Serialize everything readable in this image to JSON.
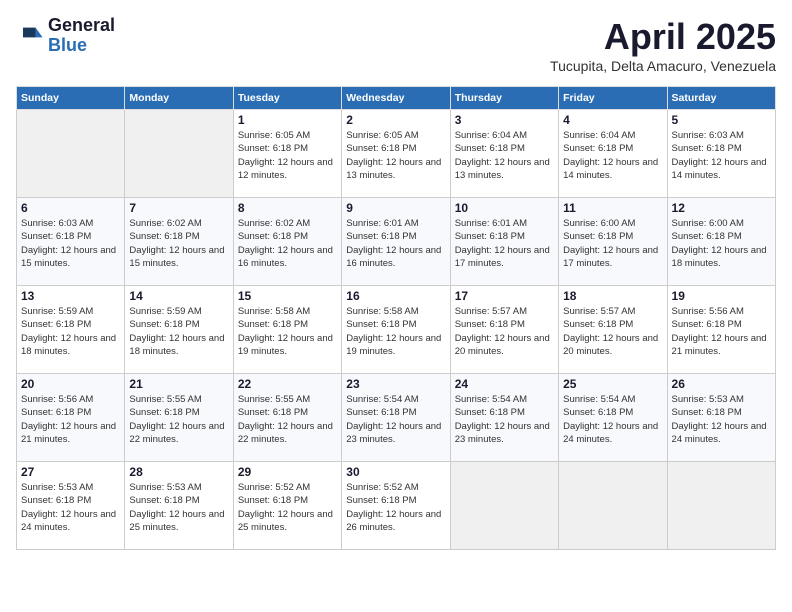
{
  "header": {
    "logo_general": "General",
    "logo_blue": "Blue",
    "month_title": "April 2025",
    "location": "Tucupita, Delta Amacuro, Venezuela"
  },
  "weekdays": [
    "Sunday",
    "Monday",
    "Tuesday",
    "Wednesday",
    "Thursday",
    "Friday",
    "Saturday"
  ],
  "weeks": [
    [
      {
        "day": null
      },
      {
        "day": null
      },
      {
        "day": "1",
        "sunrise": "6:05 AM",
        "sunset": "6:18 PM",
        "daylight": "12 hours and 12 minutes."
      },
      {
        "day": "2",
        "sunrise": "6:05 AM",
        "sunset": "6:18 PM",
        "daylight": "12 hours and 13 minutes."
      },
      {
        "day": "3",
        "sunrise": "6:04 AM",
        "sunset": "6:18 PM",
        "daylight": "12 hours and 13 minutes."
      },
      {
        "day": "4",
        "sunrise": "6:04 AM",
        "sunset": "6:18 PM",
        "daylight": "12 hours and 14 minutes."
      },
      {
        "day": "5",
        "sunrise": "6:03 AM",
        "sunset": "6:18 PM",
        "daylight": "12 hours and 14 minutes."
      }
    ],
    [
      {
        "day": "6",
        "sunrise": "6:03 AM",
        "sunset": "6:18 PM",
        "daylight": "12 hours and 15 minutes."
      },
      {
        "day": "7",
        "sunrise": "6:02 AM",
        "sunset": "6:18 PM",
        "daylight": "12 hours and 15 minutes."
      },
      {
        "day": "8",
        "sunrise": "6:02 AM",
        "sunset": "6:18 PM",
        "daylight": "12 hours and 16 minutes."
      },
      {
        "day": "9",
        "sunrise": "6:01 AM",
        "sunset": "6:18 PM",
        "daylight": "12 hours and 16 minutes."
      },
      {
        "day": "10",
        "sunrise": "6:01 AM",
        "sunset": "6:18 PM",
        "daylight": "12 hours and 17 minutes."
      },
      {
        "day": "11",
        "sunrise": "6:00 AM",
        "sunset": "6:18 PM",
        "daylight": "12 hours and 17 minutes."
      },
      {
        "day": "12",
        "sunrise": "6:00 AM",
        "sunset": "6:18 PM",
        "daylight": "12 hours and 18 minutes."
      }
    ],
    [
      {
        "day": "13",
        "sunrise": "5:59 AM",
        "sunset": "6:18 PM",
        "daylight": "12 hours and 18 minutes."
      },
      {
        "day": "14",
        "sunrise": "5:59 AM",
        "sunset": "6:18 PM",
        "daylight": "12 hours and 18 minutes."
      },
      {
        "day": "15",
        "sunrise": "5:58 AM",
        "sunset": "6:18 PM",
        "daylight": "12 hours and 19 minutes."
      },
      {
        "day": "16",
        "sunrise": "5:58 AM",
        "sunset": "6:18 PM",
        "daylight": "12 hours and 19 minutes."
      },
      {
        "day": "17",
        "sunrise": "5:57 AM",
        "sunset": "6:18 PM",
        "daylight": "12 hours and 20 minutes."
      },
      {
        "day": "18",
        "sunrise": "5:57 AM",
        "sunset": "6:18 PM",
        "daylight": "12 hours and 20 minutes."
      },
      {
        "day": "19",
        "sunrise": "5:56 AM",
        "sunset": "6:18 PM",
        "daylight": "12 hours and 21 minutes."
      }
    ],
    [
      {
        "day": "20",
        "sunrise": "5:56 AM",
        "sunset": "6:18 PM",
        "daylight": "12 hours and 21 minutes."
      },
      {
        "day": "21",
        "sunrise": "5:55 AM",
        "sunset": "6:18 PM",
        "daylight": "12 hours and 22 minutes."
      },
      {
        "day": "22",
        "sunrise": "5:55 AM",
        "sunset": "6:18 PM",
        "daylight": "12 hours and 22 minutes."
      },
      {
        "day": "23",
        "sunrise": "5:54 AM",
        "sunset": "6:18 PM",
        "daylight": "12 hours and 23 minutes."
      },
      {
        "day": "24",
        "sunrise": "5:54 AM",
        "sunset": "6:18 PM",
        "daylight": "12 hours and 23 minutes."
      },
      {
        "day": "25",
        "sunrise": "5:54 AM",
        "sunset": "6:18 PM",
        "daylight": "12 hours and 24 minutes."
      },
      {
        "day": "26",
        "sunrise": "5:53 AM",
        "sunset": "6:18 PM",
        "daylight": "12 hours and 24 minutes."
      }
    ],
    [
      {
        "day": "27",
        "sunrise": "5:53 AM",
        "sunset": "6:18 PM",
        "daylight": "12 hours and 24 minutes."
      },
      {
        "day": "28",
        "sunrise": "5:53 AM",
        "sunset": "6:18 PM",
        "daylight": "12 hours and 25 minutes."
      },
      {
        "day": "29",
        "sunrise": "5:52 AM",
        "sunset": "6:18 PM",
        "daylight": "12 hours and 25 minutes."
      },
      {
        "day": "30",
        "sunrise": "5:52 AM",
        "sunset": "6:18 PM",
        "daylight": "12 hours and 26 minutes."
      },
      {
        "day": null
      },
      {
        "day": null
      },
      {
        "day": null
      }
    ]
  ]
}
